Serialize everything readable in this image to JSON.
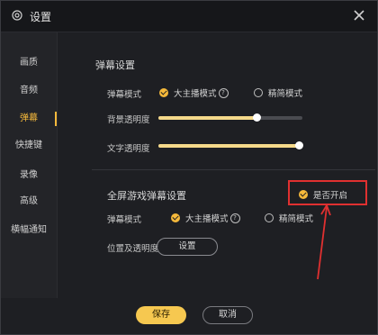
{
  "window": {
    "title": "设置"
  },
  "sidebar": {
    "items": [
      {
        "label": "画质"
      },
      {
        "label": "音频"
      },
      {
        "label": "弹幕",
        "active": true
      },
      {
        "label": "快捷键"
      },
      {
        "label": "录像"
      },
      {
        "label": "高级"
      },
      {
        "label": "横幅通知"
      }
    ]
  },
  "danmu": {
    "section_title": "弹幕设置",
    "mode_label": "弹幕模式",
    "mode_options": [
      "大主播模式",
      "精简模式"
    ],
    "mode_selected": "大主播模式",
    "bg_opacity_label": "背景透明度",
    "bg_opacity_value": 0.68,
    "text_opacity_label": "文字透明度",
    "text_opacity_value": 1.0
  },
  "fullscreen": {
    "section_title": "全屏游戏弹幕设置",
    "enable_label": "是否开启",
    "enabled": true,
    "mode_label": "弹幕模式",
    "mode_options": [
      "大主播模式",
      "精简模式"
    ],
    "mode_selected": "大主播模式",
    "position_label": "位置及透明度",
    "settings_button": "设置"
  },
  "footer": {
    "save": "保存",
    "cancel": "取消"
  },
  "colors": {
    "accent": "#f5b93b",
    "highlight": "#e03030",
    "save_bg": "#f6c850"
  }
}
